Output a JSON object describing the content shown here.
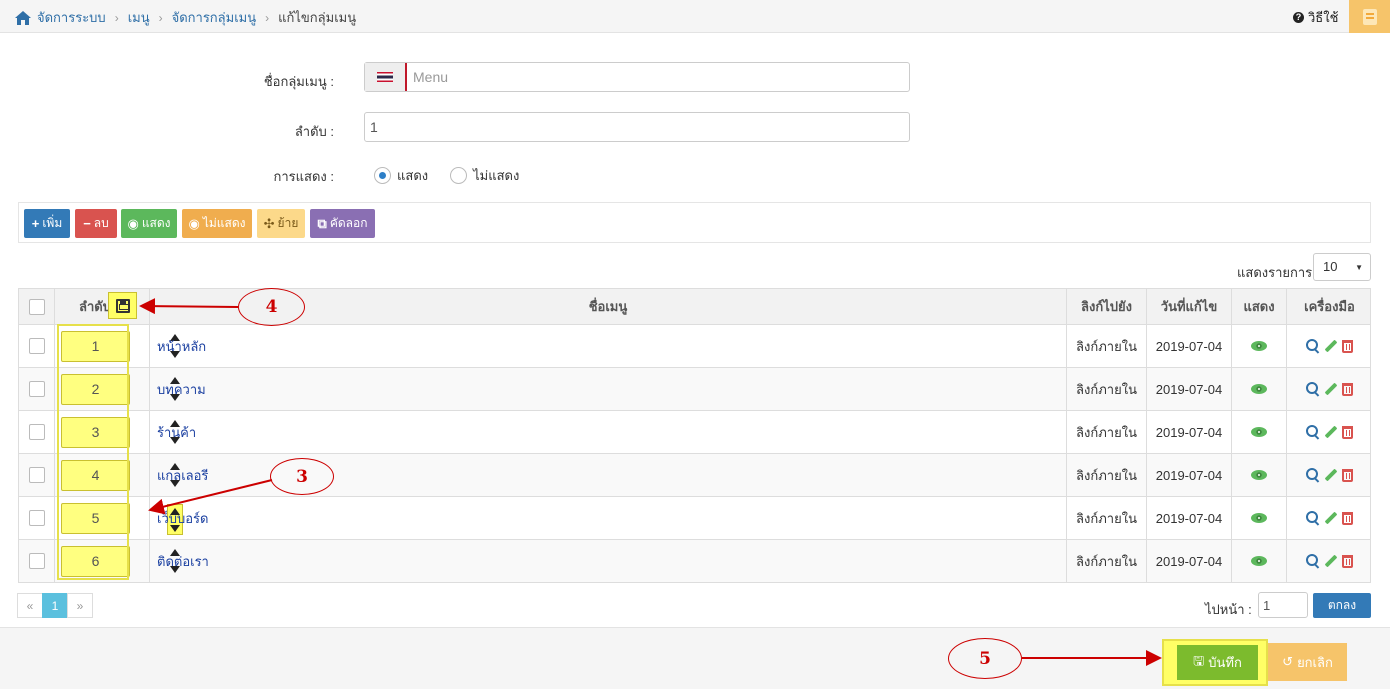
{
  "breadcrumb": {
    "items": [
      "จัดการระบบ",
      "เมนู",
      "จัดการกลุ่มเมนู"
    ],
    "current": "แก้ไขกลุ่มเมนู"
  },
  "help_label": "วิธีใช้",
  "form": {
    "name_label": "ชื่อกลุ่มเมนู :",
    "name_placeholder": "Menu",
    "order_label": "ลำดับ :",
    "order_value": "1",
    "display_label": "การแสดง :",
    "display_options": [
      "แสดง",
      "ไม่แสดง"
    ],
    "display_selected": "แสดง"
  },
  "toolbar": {
    "add": "เพิ่ม",
    "delete": "ลบ",
    "show": "แสดง",
    "hide": "ไม่แสดง",
    "move": "ย้าย",
    "copy": "คัดลอก"
  },
  "page_size": {
    "label": "แสดงรายการ",
    "value": "10"
  },
  "table": {
    "headers": {
      "order": "ลำดับ",
      "name": "ชื่อเมนู",
      "link": "ลิงก์ไปยัง",
      "date": "วันที่แก้ไข",
      "show": "แสดง",
      "tools": "เครื่องมือ"
    },
    "rows": [
      {
        "order": "1",
        "name": "หน้าหลัก",
        "link": "ลิงก์ภายใน",
        "date": "2019-07-04"
      },
      {
        "order": "2",
        "name": "บทความ",
        "link": "ลิงก์ภายใน",
        "date": "2019-07-04"
      },
      {
        "order": "3",
        "name": "ร้านค้า",
        "link": "ลิงก์ภายใน",
        "date": "2019-07-04"
      },
      {
        "order": "4",
        "name": "แกลเลอรี",
        "link": "ลิงก์ภายใน",
        "date": "2019-07-04"
      },
      {
        "order": "5",
        "name": "เว็บบอร์ด",
        "link": "ลิงก์ภายใน",
        "date": "2019-07-04"
      },
      {
        "order": "6",
        "name": "ติดต่อเรา",
        "link": "ลิงก์ภายใน",
        "date": "2019-07-04"
      }
    ]
  },
  "pagination": {
    "prev": "«",
    "current": "1",
    "next": "»"
  },
  "goto": {
    "label": "ไปหน้า :",
    "value": "1",
    "button": "ตกลง"
  },
  "footer": {
    "save": "บันทึก",
    "cancel": "ยกเลิก"
  },
  "annotations": [
    "4",
    "3",
    "5"
  ],
  "colors": {
    "primary": "#337ab7",
    "danger": "#d9534f",
    "success": "#5cb85c",
    "warning": "#f0ad4e",
    "purple": "#8a6fb3",
    "highlight": "#ffff66",
    "annotation": "#cc0000"
  }
}
